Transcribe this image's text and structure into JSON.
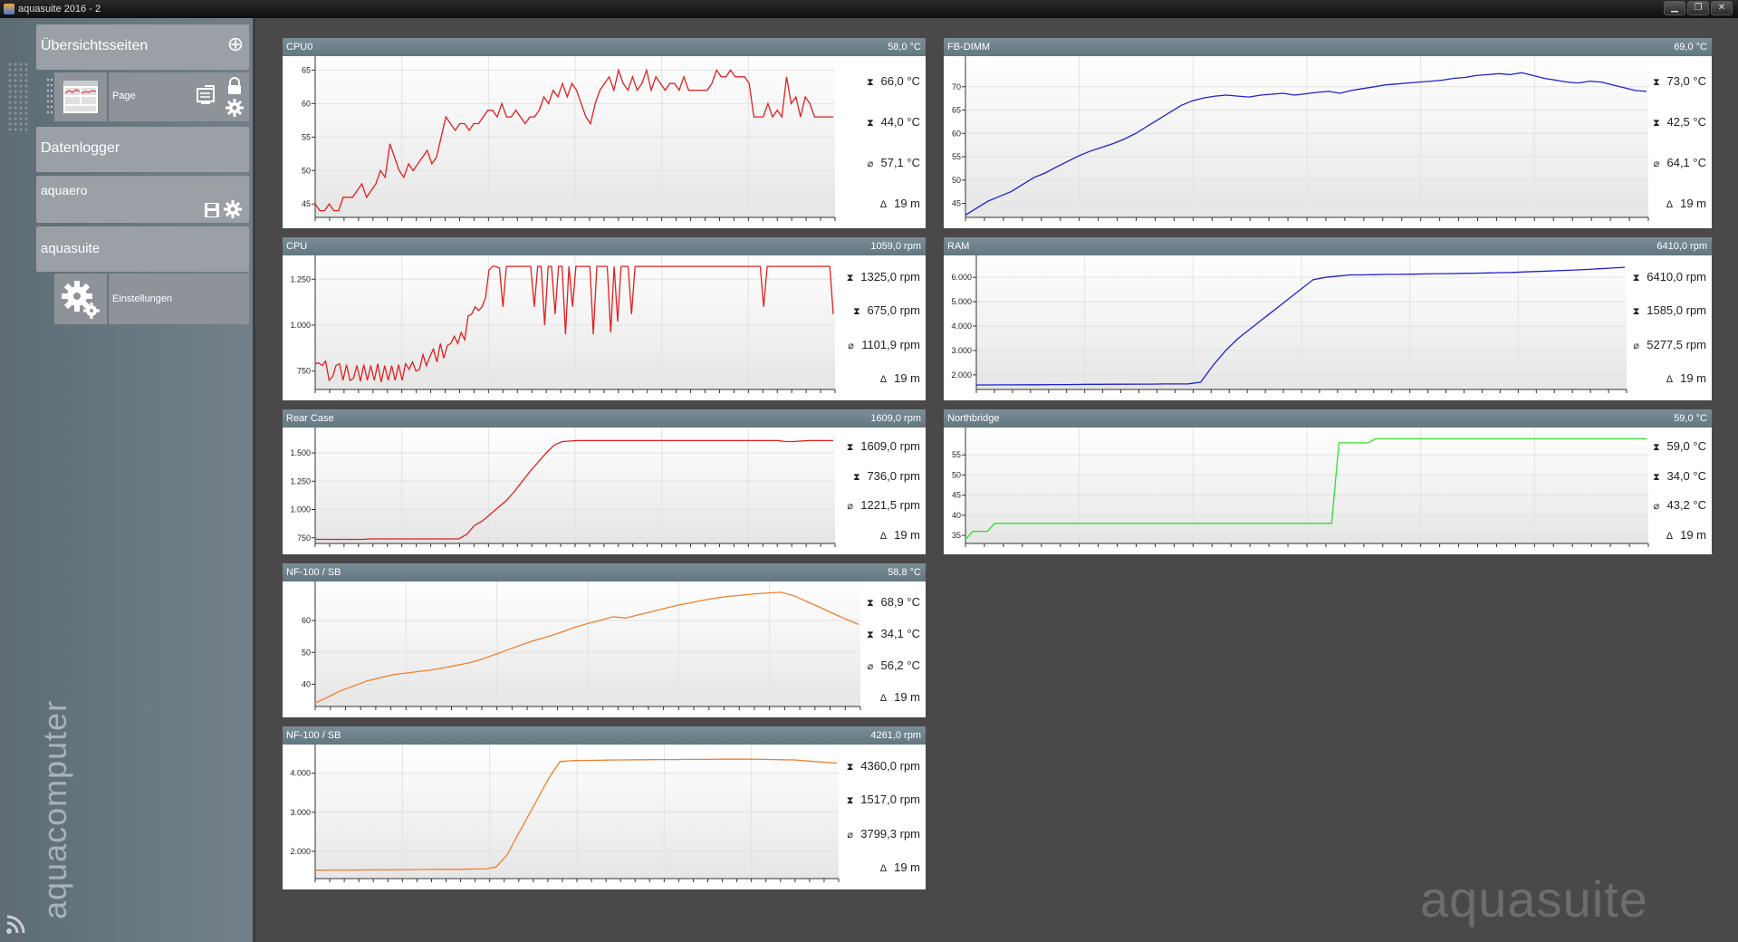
{
  "window": {
    "title": "aquasuite 2016 - 2",
    "minimize": "▁",
    "restore": "❐",
    "close": "✕"
  },
  "sidebar": {
    "overview": {
      "label": "Übersichtsseiten"
    },
    "page": {
      "label": "Page"
    },
    "datalogger": {
      "label": "Datenlogger"
    },
    "aquaero": {
      "label": "aquaero"
    },
    "aquasuite": {
      "label": "aquasuite"
    },
    "settings": {
      "label": "Einstellungen"
    },
    "brand": "aquacomputer"
  },
  "watermark": "aquasuite",
  "panels": [
    {
      "name": "CPU0",
      "current": "58,0 °C",
      "max": "66,0 °C",
      "min": "44,0 °C",
      "avg": "57,1 °C",
      "span": "19 m",
      "color": "#e02020",
      "chart_data": {
        "type": "line",
        "ylim": [
          43,
          66
        ],
        "ticks": [
          {
            "v": 45,
            "l": "45"
          },
          {
            "v": 50,
            "l": "50"
          },
          {
            "v": 55,
            "l": "55"
          },
          {
            "v": 60,
            "l": "60"
          },
          {
            "v": 65,
            "l": "65"
          }
        ],
        "values": [
          45,
          44,
          44,
          45,
          44,
          44,
          46,
          46,
          46,
          47,
          48,
          46,
          47,
          48,
          50,
          49,
          54,
          52,
          50,
          49,
          51,
          50,
          51,
          52,
          53,
          51,
          52,
          55,
          58,
          57,
          56,
          57,
          57,
          56,
          57,
          57,
          58,
          59,
          59,
          58,
          60,
          58,
          58,
          59,
          58,
          57,
          58,
          58,
          59,
          61,
          60,
          62,
          61,
          63,
          61,
          63,
          62,
          60,
          58,
          57,
          60,
          62,
          63,
          64,
          62,
          65,
          63,
          62,
          64,
          62,
          63,
          65,
          62,
          64,
          63,
          62,
          63,
          63,
          62,
          64,
          62,
          62,
          62,
          62,
          62,
          63,
          65,
          64,
          64,
          65,
          64,
          64,
          64,
          63,
          58,
          58,
          58,
          60,
          58,
          59,
          58,
          64,
          60,
          61,
          58,
          61,
          60,
          58,
          58,
          58,
          58,
          58
        ]
      }
    },
    {
      "name": "CPU",
      "current": "1059,0 rpm",
      "max": "1325,0 rpm",
      "min": "675,0 rpm",
      "avg": "1101,9 rpm",
      "span": "19 m",
      "color": "#e02020",
      "chart_data": {
        "type": "line",
        "ylim": [
          650,
          1340
        ],
        "ticks": [
          {
            "v": 750,
            "l": "750"
          },
          {
            "v": 1000,
            "l": "1.000"
          },
          {
            "v": 1250,
            "l": "1.250"
          }
        ],
        "values": [
          790,
          795,
          780,
          805,
          700,
          720,
          780,
          790,
          700,
          785,
          700,
          710,
          780,
          695,
          785,
          700,
          780,
          700,
          790,
          690,
          780,
          700,
          780,
          700,
          785,
          700,
          790,
          760,
          800,
          750,
          760,
          840,
          780,
          830,
          870,
          800,
          900,
          820,
          890,
          900,
          940,
          900,
          960,
          920,
          1050,
          1060,
          1100,
          1080,
          1100,
          1150,
          1300,
          1320,
          1320,
          1310,
          1100,
          1320,
          1320,
          1320,
          1320,
          1320,
          1320,
          1320,
          1320,
          1100,
          1320,
          1320,
          1000,
          1320,
          1320,
          1060,
          1320,
          1320,
          950,
          1320,
          1100,
          1320,
          1320,
          1320,
          1320,
          1320,
          950,
          1320,
          1320,
          1320,
          1320,
          960,
          1320,
          1020,
          1320,
          1320,
          1320,
          1060,
          1320,
          1320,
          1320,
          1320,
          1320,
          1320,
          1320,
          1320,
          1320,
          1320,
          1320,
          1320,
          1320,
          1320,
          1320,
          1320,
          1320,
          1320,
          1320,
          1320,
          1320,
          1320,
          1320,
          1320,
          1320,
          1320,
          1320,
          1320,
          1320,
          1320,
          1320,
          1320,
          1320,
          1320,
          1320,
          1320,
          1320,
          1100,
          1320,
          1320,
          1320,
          1320,
          1320,
          1320,
          1320,
          1320,
          1320,
          1320,
          1320,
          1320,
          1320,
          1320,
          1320,
          1320,
          1320,
          1320,
          1320,
          1060
        ]
      }
    },
    {
      "name": "Rear Case",
      "current": "1609,0 rpm",
      "max": "1609,0 rpm",
      "min": "736,0 rpm",
      "avg": "1221,5 rpm",
      "span": "19 m",
      "color": "#e02020",
      "chart_data": {
        "type": "line",
        "ylim": [
          700,
          1660
        ],
        "ticks": [
          {
            "v": 750,
            "l": "750"
          },
          {
            "v": 1000,
            "l": "1.000"
          },
          {
            "v": 1250,
            "l": "1.250"
          },
          {
            "v": 1500,
            "l": "1.500"
          }
        ],
        "values": [
          736,
          736,
          736,
          736,
          736,
          736,
          736,
          740,
          740,
          740,
          740,
          740,
          740,
          740,
          740,
          740,
          740,
          740,
          740,
          780,
          860,
          900,
          960,
          1020,
          1080,
          1160,
          1250,
          1340,
          1420,
          1500,
          1570,
          1600,
          1605,
          1609,
          1609,
          1609,
          1609,
          1609,
          1609,
          1609,
          1609,
          1609,
          1609,
          1609,
          1609,
          1609,
          1609,
          1609,
          1609,
          1609,
          1609,
          1609,
          1609,
          1609,
          1609,
          1609,
          1609,
          1609,
          1609,
          1600,
          1600,
          1605,
          1609,
          1609,
          1609,
          1609
        ]
      }
    },
    {
      "name": "NF-100 / SB",
      "current": "58,8 °C",
      "max": "68,9 °C",
      "min": "34,1 °C",
      "avg": "56,2 °C",
      "span": "19 m",
      "color": "#f08030",
      "chart_data": {
        "type": "line",
        "ylim": [
          33,
          70
        ],
        "ticks": [
          {
            "v": 40,
            "l": "40"
          },
          {
            "v": 50,
            "l": "50"
          },
          {
            "v": 60,
            "l": "60"
          }
        ],
        "values": [
          34.1,
          36,
          38,
          39.5,
          41,
          42,
          43,
          43.5,
          44,
          44.5,
          45.2,
          46,
          46.8,
          48,
          49.5,
          51,
          52.5,
          53.8,
          55,
          56.3,
          57.8,
          59,
          60,
          61.2,
          60.8,
          61.8,
          62.8,
          63.8,
          64.8,
          65.6,
          66.4,
          67.1,
          67.6,
          68,
          68.4,
          68.7,
          68.9,
          67.8,
          66,
          64.2,
          62.3,
          60.5,
          58.8
        ]
      }
    },
    {
      "name": "NF-100 / SB",
      "current": "4261,0 rpm",
      "max": "4360,0 rpm",
      "min": "1517,0 rpm",
      "avg": "3799,3 rpm",
      "span": "19 m",
      "color": "#f08030",
      "chart_data": {
        "type": "line",
        "ylim": [
          1300,
          4550
        ],
        "ticks": [
          {
            "v": 2000,
            "l": "2.000"
          },
          {
            "v": 3000,
            "l": "3.000"
          },
          {
            "v": 4000,
            "l": "4.000"
          }
        ],
        "values": [
          1517,
          1517,
          1520,
          1520,
          1520,
          1525,
          1525,
          1525,
          1530,
          1530,
          1535,
          1535,
          1540,
          1540,
          1540,
          1545,
          1545,
          1600,
          1900,
          2400,
          2900,
          3400,
          3900,
          4300,
          4320,
          4330,
          4330,
          4335,
          4340,
          4340,
          4345,
          4345,
          4350,
          4350,
          4350,
          4355,
          4355,
          4355,
          4360,
          4360,
          4360,
          4360,
          4355,
          4350,
          4345,
          4340,
          4320,
          4300,
          4280,
          4261
        ]
      }
    },
    {
      "name": "FB-DIMM",
      "current": "69,0 °C",
      "max": "73,0 °C",
      "min": "42,5 °C",
      "avg": "64,1 °C",
      "span": "19 m",
      "color": "#2020d0",
      "chart_data": {
        "type": "line",
        "ylim": [
          42,
          75
        ],
        "ticks": [
          {
            "v": 45,
            "l": "45"
          },
          {
            "v": 50,
            "l": "50"
          },
          {
            "v": 55,
            "l": "55"
          },
          {
            "v": 60,
            "l": "60"
          },
          {
            "v": 65,
            "l": "65"
          },
          {
            "v": 70,
            "l": "70"
          }
        ],
        "values": [
          42.5,
          44,
          45.5,
          46.5,
          47.5,
          49,
          50.5,
          51.5,
          52.8,
          54,
          55.2,
          56.2,
          57,
          57.8,
          58.8,
          60,
          61.5,
          63,
          64.5,
          66,
          67,
          67.6,
          68,
          68.2,
          68,
          67.8,
          68.2,
          68.4,
          68.6,
          68.2,
          68.5,
          68.8,
          69,
          68.6,
          69.2,
          69.6,
          70,
          70.4,
          70.6,
          70.8,
          71,
          71.2,
          71.4,
          71.8,
          72,
          72.4,
          72.6,
          72.8,
          72.6,
          73,
          72.4,
          71.8,
          71.4,
          71,
          70.8,
          71.2,
          71,
          70.4,
          69.8,
          69.2,
          69
        ]
      }
    },
    {
      "name": "RAM",
      "current": "6410,0 rpm",
      "max": "6410,0 rpm",
      "min": "1585,0 rpm",
      "avg": "5277,5 rpm",
      "span": "19 m",
      "color": "#2020d0",
      "chart_data": {
        "type": "line",
        "ylim": [
          1400,
          6600
        ],
        "ticks": [
          {
            "v": 2000,
            "l": "2.000"
          },
          {
            "v": 3000,
            "l": "3.000"
          },
          {
            "v": 4000,
            "l": "4.000"
          },
          {
            "v": 5000,
            "l": "5.000"
          },
          {
            "v": 6000,
            "l": "6.000"
          }
        ],
        "values": [
          1585,
          1585,
          1590,
          1590,
          1595,
          1595,
          1600,
          1600,
          1605,
          1610,
          1610,
          1615,
          1615,
          1620,
          1620,
          1625,
          1625,
          1630,
          1700,
          2400,
          3000,
          3500,
          3900,
          4300,
          4700,
          5100,
          5500,
          5900,
          6000,
          6050,
          6100,
          6100,
          6110,
          6120,
          6120,
          6130,
          6140,
          6150,
          6150,
          6160,
          6170,
          6180,
          6190,
          6200,
          6220,
          6240,
          6260,
          6280,
          6300,
          6320,
          6350,
          6380,
          6410
        ]
      }
    },
    {
      "name": "Northbridge",
      "current": "59,0 °C",
      "max": "59,0 °C",
      "min": "34,0 °C",
      "avg": "43,2 °C",
      "span": "19 m",
      "color": "#30e030",
      "chart_data": {
        "type": "line",
        "ylim": [
          33,
          60
        ],
        "ticks": [
          {
            "v": 35,
            "l": "35"
          },
          {
            "v": 40,
            "l": "40"
          },
          {
            "v": 45,
            "l": "45"
          },
          {
            "v": 50,
            "l": "50"
          },
          {
            "v": 55,
            "l": "55"
          }
        ],
        "values": [
          34,
          36,
          36,
          36,
          38,
          38,
          38,
          38,
          38,
          38,
          38,
          38,
          38,
          38,
          38,
          38,
          38,
          38,
          38,
          38,
          38,
          38,
          38,
          38,
          38,
          38,
          38,
          38,
          38,
          38,
          38,
          38,
          38,
          38,
          38,
          38,
          38,
          38,
          38,
          38,
          38,
          38,
          38,
          38,
          38,
          38,
          38,
          38,
          38,
          38,
          38,
          58,
          58,
          58,
          58,
          58,
          59,
          59,
          59,
          59,
          59,
          59,
          59,
          59,
          59,
          59,
          59,
          59,
          59,
          59,
          59,
          59,
          59,
          59,
          59,
          59,
          59,
          59,
          59,
          59,
          59,
          59,
          59,
          59,
          59,
          59,
          59,
          59,
          59,
          59,
          59,
          59,
          59,
          59
        ]
      }
    }
  ],
  "icons": {
    "add": "plus-circle-icon",
    "lock": "lock-icon",
    "gear": "gear-icon",
    "save": "floppy-icon",
    "max": "max-arrow-icon",
    "min": "min-arrow-icon",
    "avg": "average-icon",
    "span": "timespan-icon"
  }
}
